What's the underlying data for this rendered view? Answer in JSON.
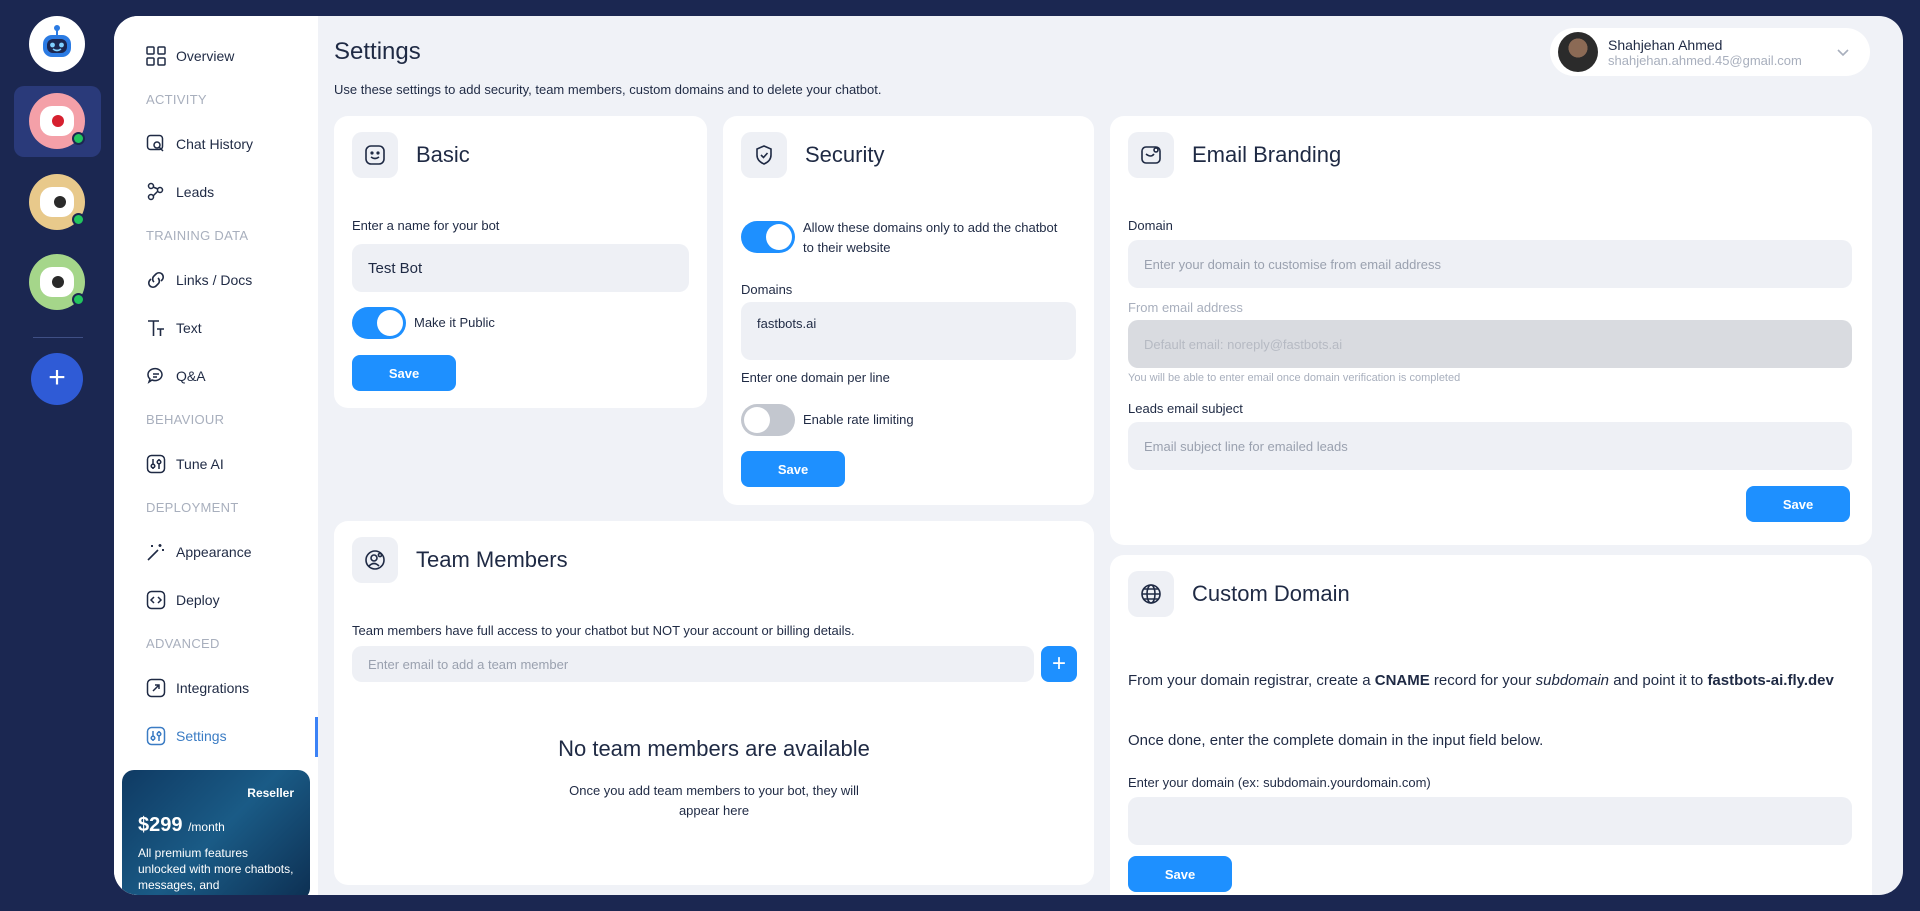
{
  "sidebar": {
    "overview": "Overview",
    "section_activity": "ACTIVITY",
    "chat_history": "Chat History",
    "leads": "Leads",
    "section_training": "TRAINING DATA",
    "links_docs": "Links / Docs",
    "text": "Text",
    "qa": "Q&A",
    "section_behaviour": "BEHAVIOUR",
    "tune_ai": "Tune AI",
    "section_deployment": "DEPLOYMENT",
    "appearance": "Appearance",
    "deploy": "Deploy",
    "section_advanced": "ADVANCED",
    "integrations": "Integrations",
    "settings": "Settings"
  },
  "promo": {
    "badge": "Reseller",
    "price": "$299",
    "period": "/month",
    "desc": "All premium features unlocked with more chatbots, messages, and"
  },
  "header": {
    "title": "Settings",
    "subtitle": "Use these settings to add security, team members, custom domains and to delete your chatbot."
  },
  "user": {
    "name": "Shahjehan Ahmed",
    "email": "shahjehan.ahmed.45@gmail.com"
  },
  "basic": {
    "title": "Basic",
    "name_label": "Enter a name for your bot",
    "name_value": "Test Bot",
    "public_label": "Make it Public",
    "save": "Save"
  },
  "security": {
    "title": "Security",
    "allow_label": "Allow these domains only to add the chatbot to their website",
    "domains_label": "Domains",
    "domains_value": "fastbots.ai",
    "domains_hint": "Enter one domain per line",
    "rate_label": "Enable rate limiting",
    "save": "Save"
  },
  "email_branding": {
    "title": "Email Branding",
    "domain_label": "Domain",
    "domain_placeholder": "Enter your domain to customise from email address",
    "from_label": "From email address",
    "from_placeholder": "Default email: noreply@fastbots.ai",
    "from_hint": "You will be able to enter email once domain verification is completed",
    "subject_label": "Leads email subject",
    "subject_placeholder": "Email subject line for emailed leads",
    "save": "Save"
  },
  "team": {
    "title": "Team Members",
    "desc": "Team members have full access to your chatbot but NOT your account or billing details.",
    "email_placeholder": "Enter email to add a team member",
    "empty_title": "No team members are available",
    "empty_desc": "Once you add team members to your bot, they will appear here"
  },
  "custom_domain": {
    "title": "Custom Domain",
    "p1_a": "From your domain registrar, create a ",
    "p1_b": "CNAME",
    "p1_c": " record for your ",
    "p1_d": "subdomain",
    "p1_e": " and point it to ",
    "p1_f": "fastbots-ai.fly.dev",
    "p2": "Once done, enter the complete domain in the input field below.",
    "domain_label": "Enter your domain (ex: subdomain.yourdomain.com)",
    "save": "Save"
  },
  "colors": {
    "accent": "#1e90ff",
    "rail": "#1b2751",
    "online": "#22c55e"
  }
}
